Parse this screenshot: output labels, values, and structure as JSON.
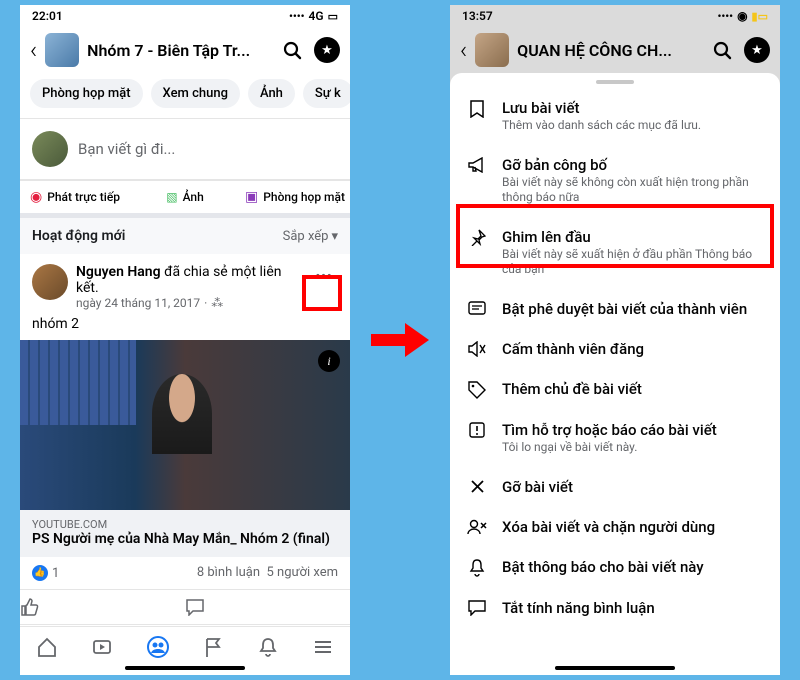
{
  "left": {
    "status": {
      "time": "22:01",
      "network": "4G"
    },
    "header": {
      "group_name": "Nhóm 7 - Biên Tập Tr..."
    },
    "chips": [
      "Phòng họp mặt",
      "Xem chung",
      "Ảnh",
      "Sự k"
    ],
    "composer": {
      "placeholder": "Bạn viết gì đi...",
      "live": "Phát trực tiếp",
      "photo": "Ảnh",
      "room": "Phòng họp mặt"
    },
    "activity": {
      "title": "Hoạt động mới",
      "sort": "Sắp xếp"
    },
    "post": {
      "author": "Nguyen Hang",
      "action_text": "đã chia sẻ một liên kết.",
      "time": "ngày 24 tháng 11, 2017",
      "caption": "nhóm 2",
      "link_source": "YOUTUBE.COM",
      "link_title": "PS Người mẹ của Nhà May Mắn_ Nhóm 2 (final)",
      "like_count": "1",
      "comments": "8 bình luận",
      "viewers": "5 người xem"
    }
  },
  "right": {
    "status": {
      "time": "13:57"
    },
    "header": {
      "group_name": "QUAN HỆ CÔNG CH..."
    },
    "menu": [
      {
        "icon": "bookmark",
        "title": "Lưu bài viết",
        "sub": "Thêm vào danh sách các mục đã lưu."
      },
      {
        "icon": "megaphone",
        "title": "Gỡ bản công bố",
        "sub": "Bài viết này sẽ không còn xuất hiện trong phần thông báo nữa"
      },
      {
        "icon": "pin",
        "title": "Ghim lên đầu",
        "sub": "Bài viết này sẽ xuất hiện ở đầu phần Thông báo của bạn"
      },
      {
        "icon": "approve",
        "title": "Bật phê duyệt bài viết của thành viên",
        "sub": ""
      },
      {
        "icon": "mute",
        "title": "Cấm thành viên đăng",
        "sub": ""
      },
      {
        "icon": "tag",
        "title": "Thêm chủ đề bài viết",
        "sub": ""
      },
      {
        "icon": "report",
        "title": "Tìm hỗ trợ hoặc báo cáo bài viết",
        "sub": "Tôi lo ngại về bài viết này."
      },
      {
        "icon": "close",
        "title": "Gỡ bài viết",
        "sub": ""
      },
      {
        "icon": "block-user",
        "title": "Xóa bài viết và chặn người dùng",
        "sub": ""
      },
      {
        "icon": "bell",
        "title": "Bật thông báo cho bài viết này",
        "sub": ""
      },
      {
        "icon": "comment-off",
        "title": "Tắt tính năng bình luận",
        "sub": ""
      }
    ]
  }
}
